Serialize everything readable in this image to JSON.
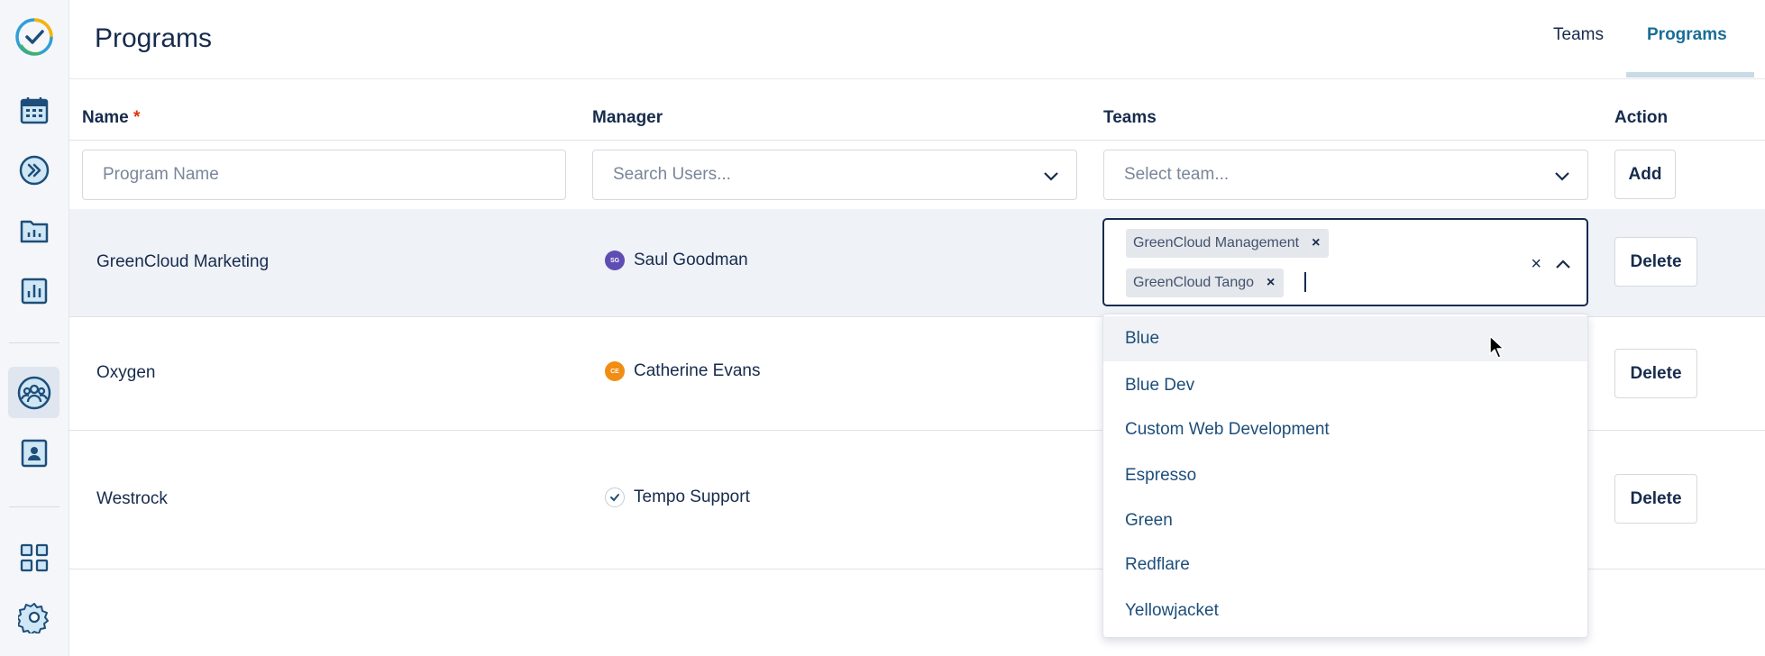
{
  "header": {
    "title": "Programs",
    "tabs": [
      {
        "label": "Teams",
        "active": false
      },
      {
        "label": "Programs",
        "active": true
      }
    ]
  },
  "sidebar": {
    "items": [
      {
        "icon": "tempo-logo-icon"
      },
      {
        "icon": "calendar-icon"
      },
      {
        "icon": "forward-circle-icon"
      },
      {
        "icon": "folder-chart-icon"
      },
      {
        "icon": "bar-chart-icon"
      },
      {
        "icon": "team-icon",
        "active": true
      },
      {
        "icon": "user-card-icon"
      },
      {
        "icon": "apps-grid-icon"
      },
      {
        "icon": "gear-icon"
      }
    ]
  },
  "table": {
    "columns": {
      "name": "Name",
      "required_marker": "*",
      "manager": "Manager",
      "teams": "Teams",
      "action": "Action"
    },
    "new_row": {
      "name_placeholder": "Program Name",
      "manager_placeholder": "Search Users...",
      "teams_placeholder": "Select team...",
      "add_label": "Add"
    },
    "rows": [
      {
        "name": "GreenCloud Marketing",
        "manager": "Saul Goodman",
        "avatar_initials": "SG",
        "avatar_color": "#5e4db2",
        "action": "Delete"
      },
      {
        "name": "Oxygen",
        "manager": "Catherine Evans",
        "avatar_initials": "CE",
        "avatar_color": "#f18d13",
        "action": "Delete"
      },
      {
        "name": "Westrock",
        "manager": "Tempo Support",
        "avatar_initials": "",
        "avatar_color": "#ffffff",
        "action": "Delete"
      }
    ]
  },
  "team_select": {
    "selected": [
      "GreenCloud Management",
      "GreenCloud Tango"
    ],
    "clear_symbol": "×",
    "remove_symbol": "×",
    "options": [
      "Blue",
      "Blue Dev",
      "Custom Web Development",
      "Espresso",
      "Green",
      "Redflare",
      "Yellowjacket"
    ],
    "hovered_option": "Blue"
  },
  "colors": {
    "accent": "#1a6d96",
    "text": "#172b4d",
    "required": "#de350b",
    "selected_row": "#eff2f7"
  }
}
